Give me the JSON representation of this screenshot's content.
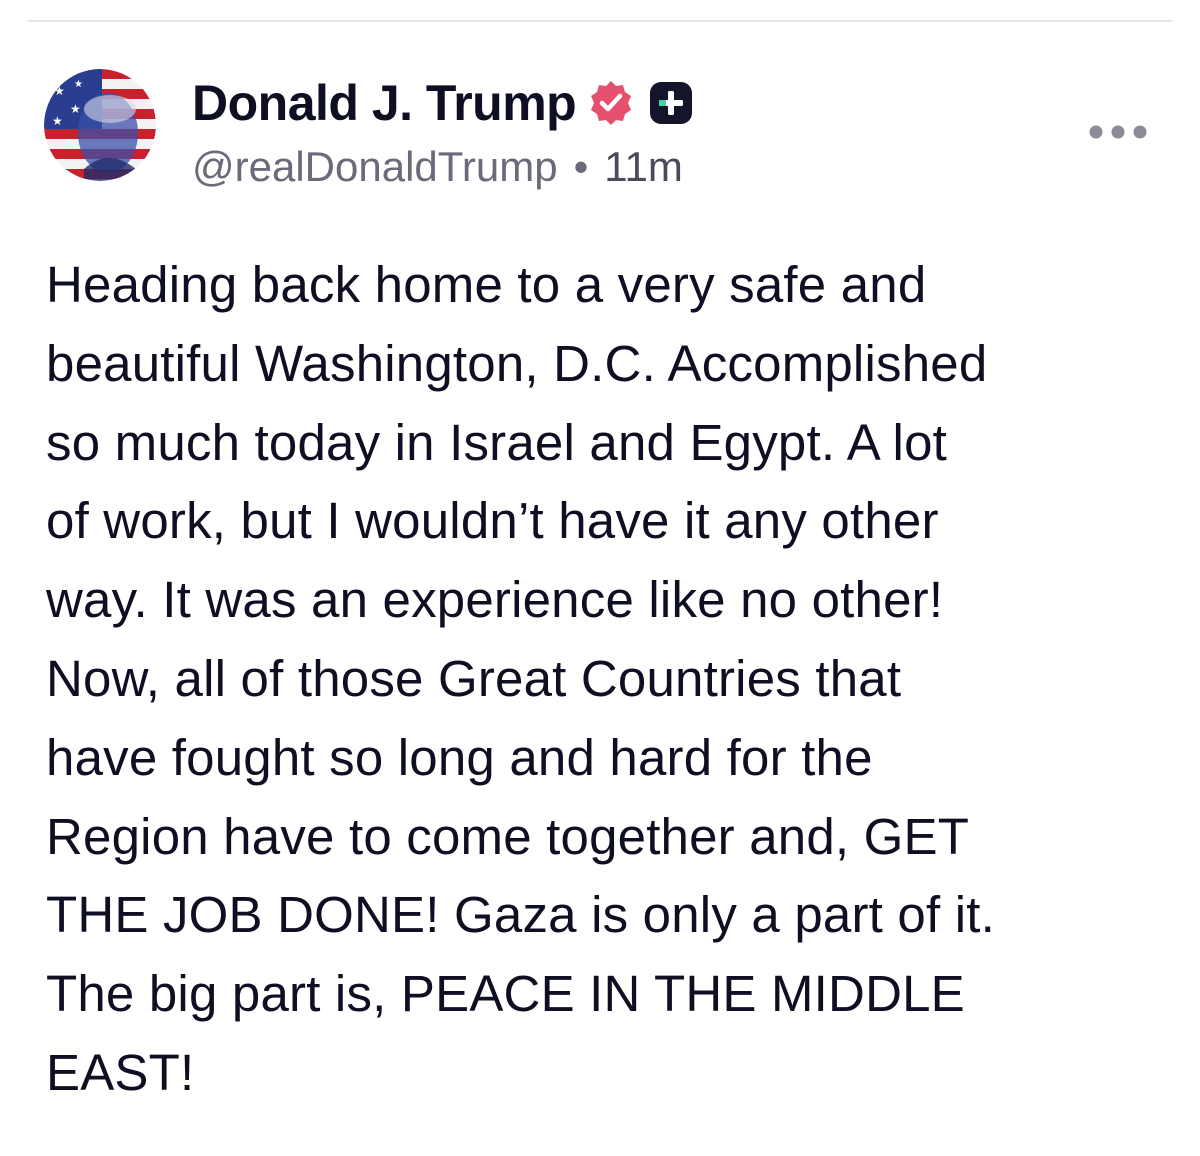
{
  "author": {
    "display_name": "Donald J. Trump",
    "handle": "@realDonaldTrump",
    "separator": "•",
    "timestamp": "11m",
    "verified_icon": "verified-badge-icon",
    "plus_icon": "plus-badge-icon"
  },
  "post": {
    "lines": [
      "Heading back home to a very safe and",
      "beautiful Washington, D.C. Accomplished",
      "so much today in Israel and Egypt. A lot",
      "of work, but I wouldn’t have it any other",
      "way. It was an experience like no other!",
      "Now, all of those Great Countries that",
      "have fought so long and hard for the",
      "Region have to come together and, GET",
      "THE JOB DONE! Gaza is only a part of it.",
      "The big part is, PEACE IN THE MIDDLE",
      "EAST!"
    ]
  },
  "colors": {
    "text": "#0f0f23",
    "muted": "#6a6a7a",
    "verified": "#e5506e",
    "divider": "#e4e4ea"
  }
}
